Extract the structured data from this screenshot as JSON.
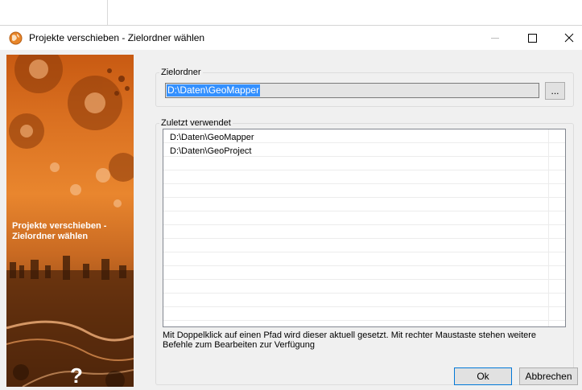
{
  "window": {
    "title": "Projekte verschieben - Zielordner wählen"
  },
  "sidebar": {
    "heading": "Projekte verschieben - Zielordner wählen",
    "help_icon": "question-mark-icon"
  },
  "target_folder": {
    "group_label": "Zielordner",
    "path_value": "D:\\Daten\\GeoMapper",
    "browse_label": "..."
  },
  "recent": {
    "group_label": "Zuletzt verwendet",
    "items": [
      "D:\\Daten\\GeoMapper",
      "D:\\Daten\\GeoProject"
    ],
    "hint": "Mit Doppelklick auf einen Pfad wird dieser aktuell gesetzt. Mit rechter Maustaste stehen weitere Befehle zum Bearbeiten zur Verfügung"
  },
  "buttons": {
    "ok": "Ok",
    "cancel": "Abbrechen"
  },
  "colors": {
    "selection": "#3390ff",
    "ok_border": "#0078d7",
    "sidebar_orange": "#e9862e"
  }
}
